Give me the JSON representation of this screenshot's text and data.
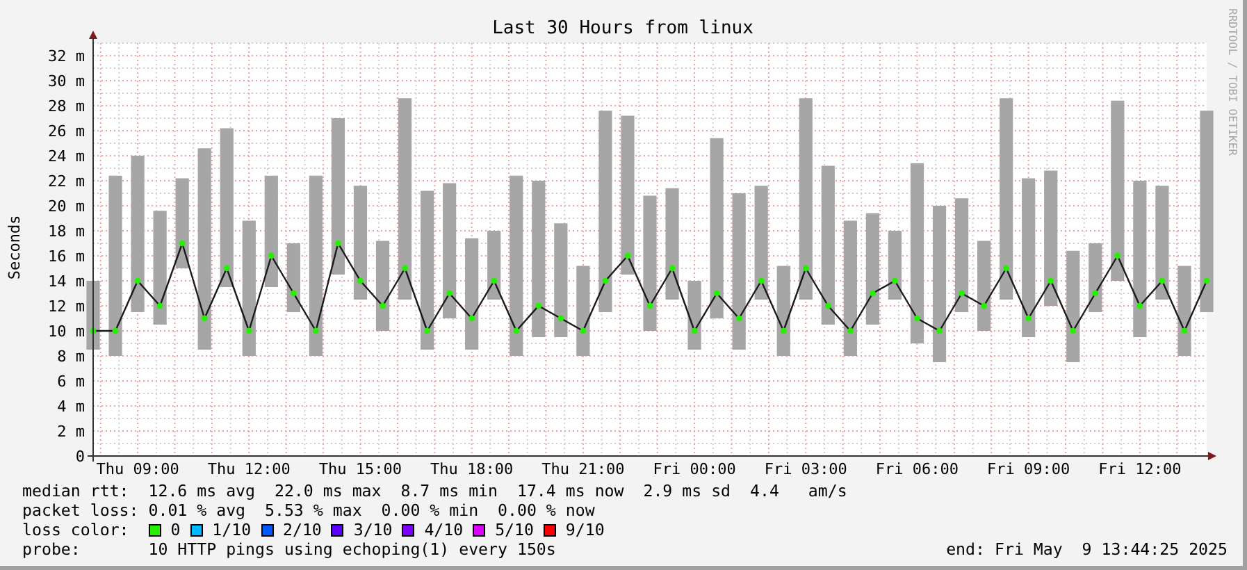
{
  "graph": {
    "credit": "RRDTOOL / TOBI OETIKER",
    "chart_data": {
      "type": "line",
      "title": "Last 30 Hours from linux",
      "ylabel": "Seconds",
      "categories": [
        null,
        null,
        "Thu 09:00",
        null,
        null,
        null,
        null,
        "Thu 12:00",
        null,
        null,
        null,
        null,
        "Thu 15:00",
        null,
        null,
        null,
        null,
        "Thu 18:00",
        null,
        null,
        null,
        null,
        "Thu 21:00",
        null,
        null,
        null,
        null,
        "Fri 00:00",
        null,
        null,
        null,
        null,
        "Fri 03:00",
        null,
        null,
        null,
        null,
        "Fri 06:00",
        null,
        null,
        null,
        null,
        "Fri 09:00",
        null,
        null,
        null,
        null,
        "Fri 12:00",
        null,
        null,
        null
      ],
      "grid": true,
      "series": [
        {
          "color": "#1a1a1a",
          "marker": "circle",
          "errors": [
            [
              8.5,
              14
            ],
            [
              8,
              22.4
            ],
            [
              11.5,
              24
            ],
            [
              10.5,
              19.6
            ],
            [
              15,
              22.2
            ],
            [
              8.5,
              24.6
            ],
            [
              13.5,
              26.2
            ],
            [
              8,
              18.8
            ],
            [
              13.5,
              22.4
            ],
            [
              11.5,
              17
            ],
            [
              8,
              22.4
            ],
            [
              14.5,
              27
            ],
            [
              12.5,
              21.6
            ],
            [
              10,
              17.2
            ],
            [
              12.5,
              28.6
            ],
            [
              8.5,
              21.2
            ],
            [
              11,
              21.8
            ],
            [
              8.5,
              17.4
            ],
            [
              12.5,
              18
            ],
            [
              8,
              22.4
            ],
            [
              9.5,
              22
            ],
            [
              9.5,
              18.6
            ],
            [
              8,
              15.2
            ],
            [
              11.5,
              27.6
            ],
            [
              14.5,
              27.2
            ],
            [
              10,
              20.8
            ],
            [
              12.5,
              21.4
            ],
            [
              8.5,
              14
            ],
            [
              11,
              25.4
            ],
            [
              8.5,
              21
            ],
            [
              12.5,
              21.6
            ],
            [
              8,
              15.2
            ],
            [
              12.5,
              28.6
            ],
            [
              10.5,
              23.2
            ],
            [
              8,
              18.8
            ],
            [
              10.5,
              19.4
            ],
            [
              12.5,
              18
            ],
            [
              9,
              23.4
            ],
            [
              7.5,
              20
            ],
            [
              11.5,
              20.6
            ],
            [
              10,
              17.2
            ],
            [
              12.5,
              28.6
            ],
            [
              9.5,
              22.2
            ],
            [
              12,
              22.8
            ],
            [
              7.5,
              16.4
            ],
            [
              11.5,
              17
            ],
            [
              14,
              28.4
            ],
            [
              9.5,
              22
            ],
            [
              12.5,
              21.6
            ],
            [
              8,
              15.2
            ],
            [
              11.5,
              27.6
            ]
          ],
          "values": [
            10,
            10,
            14,
            12,
            17,
            11,
            15,
            10,
            16,
            13,
            10,
            17,
            14,
            12,
            15,
            10,
            13,
            11,
            14,
            10,
            12,
            11,
            10,
            14,
            16,
            12,
            15,
            10,
            13,
            11,
            14,
            10,
            15,
            12,
            10,
            13,
            14,
            11,
            10,
            13,
            12,
            15,
            11,
            14,
            10,
            13,
            16,
            12,
            14,
            10,
            14
          ]
        }
      ],
      "ylim": [
        0,
        33
      ],
      "yticks": [
        {
          "value": 0,
          "label": "0"
        },
        {
          "value": 2,
          "label": "2 m"
        },
        {
          "value": 4,
          "label": "4 m"
        },
        {
          "value": 6,
          "label": "6 m"
        },
        {
          "value": 8,
          "label": "8 m"
        },
        {
          "value": 10,
          "label": "10 m"
        },
        {
          "value": 12,
          "label": "12 m"
        },
        {
          "value": 14,
          "label": "14 m"
        },
        {
          "value": 16,
          "label": "16 m"
        },
        {
          "value": 18,
          "label": "18 m"
        },
        {
          "value": 20,
          "label": "20 m"
        },
        {
          "value": 22,
          "label": "22 m"
        },
        {
          "value": 24,
          "label": "24 m"
        },
        {
          "value": 26,
          "label": "26 m"
        },
        {
          "value": 28,
          "label": "28 m"
        },
        {
          "value": 30,
          "label": "30 m"
        },
        {
          "value": 32,
          "label": "32 m"
        }
      ]
    }
  },
  "stats": [
    {
      "label": "median rtt:",
      "value": "12.6 ms avg  22.0 ms max  8.7 ms min  17.4 ms now  2.9 ms sd  4.4   am/s"
    },
    {
      "label": "packet loss:",
      "value": "0.01 % avg  5.53 % max  0.00 % min  0.00 % now"
    }
  ],
  "loss_color": {
    "label": "loss color:",
    "items": [
      {
        "label": "0",
        "color": "#26f000"
      },
      {
        "label": "1/10",
        "color": "#00b8ff"
      },
      {
        "label": "2/10",
        "color": "#0059ff"
      },
      {
        "label": "3/10",
        "color": "#5e00ff"
      },
      {
        "label": "4/10",
        "color": "#7e00ff"
      },
      {
        "label": "5/10",
        "color": "#dd00ff"
      },
      {
        "label": "9/10",
        "color": "#ff0000"
      }
    ]
  },
  "probe": {
    "label": "probe:",
    "value": "10 HTTP pings using echoping(1) every 150s"
  },
  "end": "end: Fri May  9 13:44:25 2025"
}
